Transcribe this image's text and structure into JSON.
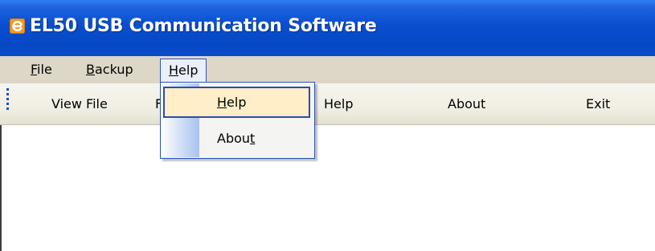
{
  "window": {
    "title": "EL50 USB Communication Software"
  },
  "menubar": {
    "file": {
      "pre": "",
      "u": "F",
      "post": "ile"
    },
    "backup": {
      "pre": "",
      "u": "B",
      "post": "ackup"
    },
    "help": {
      "pre": "",
      "u": "H",
      "post": "elp"
    }
  },
  "toolbar": {
    "view_file": "View File",
    "obscured_letter": "F",
    "help": "Help",
    "about": "About",
    "exit": "Exit"
  },
  "help_menu": {
    "help": {
      "pre": "",
      "u": "H",
      "post": "elp"
    },
    "about": {
      "pre": "Abou",
      "u": "t",
      "post": ""
    }
  },
  "colors": {
    "titlebar": "#0a4ecf",
    "menubar": "#ddd7c8",
    "highlight": "#ffeec7",
    "selection_border": "#2a4fa8"
  },
  "icons": {
    "app": "app-e-icon",
    "grip": "toolbar-grip"
  }
}
